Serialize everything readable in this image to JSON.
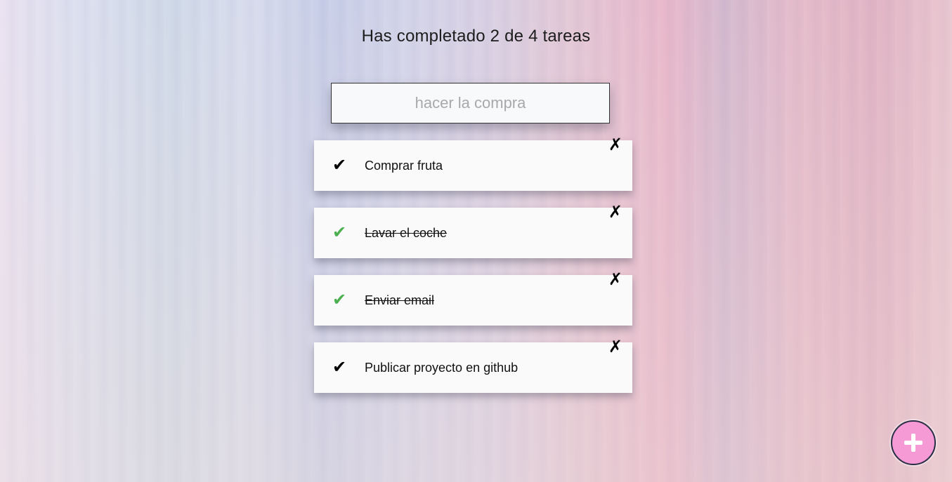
{
  "header": {
    "title": "Has completado 2 de 4 tareas"
  },
  "new_task": {
    "placeholder": "hacer la compra",
    "value": ""
  },
  "tasks": [
    {
      "label": "Comprar fruta",
      "done": false,
      "check_icon": "✔",
      "delete_icon": "✗"
    },
    {
      "label": "Lavar el coche",
      "done": true,
      "check_icon": "✔",
      "delete_icon": "✗"
    },
    {
      "label": "Enviar email",
      "done": true,
      "check_icon": "✔",
      "delete_icon": "✗"
    },
    {
      "label": "Publicar proyecto en github",
      "done": false,
      "check_icon": "✔",
      "delete_icon": "✗"
    }
  ],
  "add_button": {
    "icon": "plus-icon",
    "background_color": "#f69ad6"
  },
  "colors": {
    "done_check": "#4caf50",
    "pending_check": "#000000"
  }
}
